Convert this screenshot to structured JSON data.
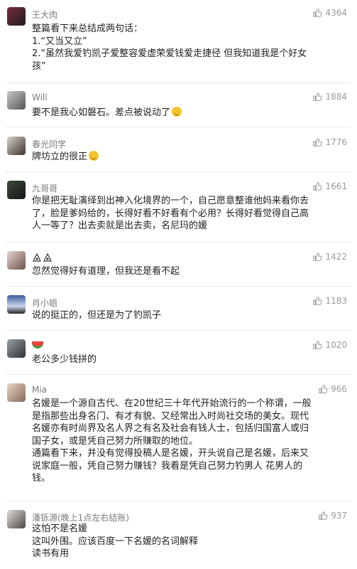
{
  "comments": [
    {
      "username": "王大肉",
      "likes": "4364",
      "lines": [
        "整篇看下来总结成两句话：",
        "1.“又当又立”",
        "2.“虽然我爱钓凯子爱整容爱虚荣爱钱爱走捷径 但我知道我是个好女",
        "孩”"
      ]
    },
    {
      "username": "Will",
      "likes": "1884",
      "lines": [
        "要不是我心如磐石。差点被说动了"
      ]
    },
    {
      "username": "春光同学",
      "likes": "1776",
      "lines": [
        "牌坊立的很正"
      ]
    },
    {
      "username": "九哥哥",
      "likes": "1661",
      "lines": [
        "你是把无耻演绎到出神入化境界的一个，自己愿意整谁他妈来看你去",
        "了，脸是爹妈给的，长得好看不好看有个必用？长得好看觉得自己高",
        "人一等了？出去卖就是出去卖，名尼玛的媛"
      ]
    },
    {
      "username": "",
      "likes": "1422",
      "lines": [
        "忽然觉得好有道理，但我还是看不起"
      ]
    },
    {
      "username": "肖小姐",
      "likes": "1183",
      "lines": [
        "说的挺正的，但还是为了钓凯子"
      ]
    },
    {
      "username": "",
      "likes": "1020",
      "lines": [
        "老公多少钱拼的"
      ]
    },
    {
      "username": "Mia",
      "likes": "966",
      "lines": [
        "名媛是一个源自古代、在20世纪三十年代开始流行的一个称谓，一般",
        "是指那些出身名门、有才有貌、又经常出入时尚社交场的美女。现代",
        "名媛亦有时尚界及名人界之有名及社会有钱人士，包括归国富人或归",
        "国子女，或是凭自己努力所赚取的地位。",
        "通篇看下来，并没有觉得投稿人是名媛，开头说自己是名媛，后来又",
        "说家庭一般，凭自己努力赚钱？我看是凭自己努力钓男人 花男人的",
        "钱。"
      ]
    },
    {
      "username": "潘铄源(晚上1点左右结账)",
      "likes": "937",
      "lines": [
        "这怕不是名媛",
        "这叫外围。应该百度一下名媛的名词解释",
        "读书有用"
      ]
    }
  ],
  "colors": {
    "text": "#1f1f1f",
    "username": "#7a7a7a",
    "likes": "#9a9a9a",
    "divider": "#e9e9e9"
  },
  "icons": {
    "like": "thumbs-up-icon",
    "emoji": "laughing-emoji-icon"
  }
}
